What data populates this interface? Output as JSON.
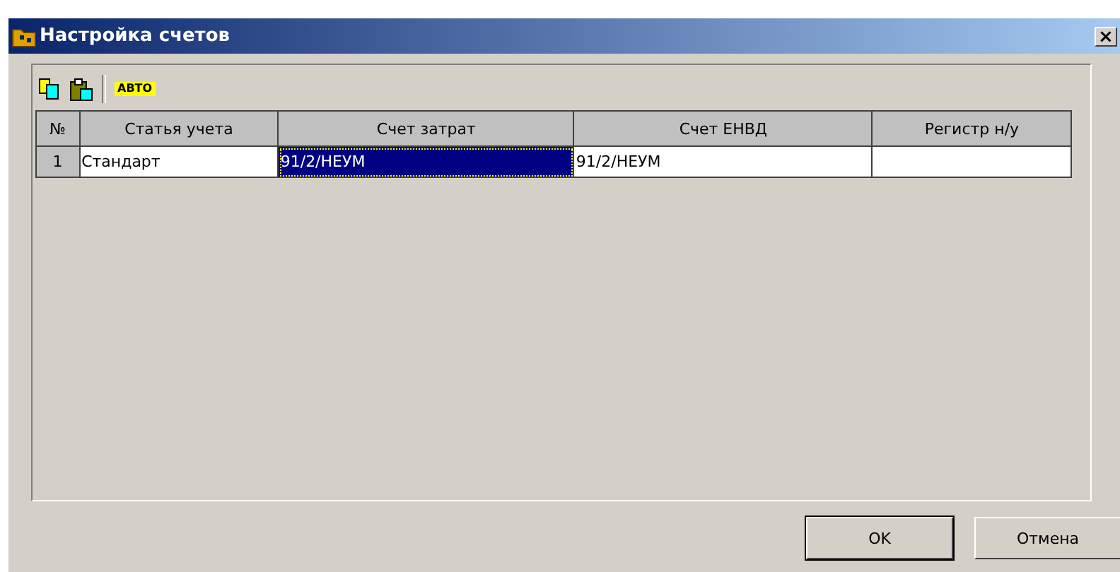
{
  "window": {
    "title": "Настройка счетов",
    "close": "×"
  },
  "toolbar": [
    {
      "kind": "copy"
    },
    {
      "kind": "paste"
    },
    {
      "kind": "separator"
    },
    {
      "kind": "auto",
      "label": "АВТО"
    }
  ],
  "table": {
    "columns": [
      "№",
      "Статья учета",
      "Счет затрат",
      "Счет ЕНВД",
      "Регистр н/у"
    ],
    "rows": [
      {
        "cells": [
          {
            "text": "1",
            "selected": false
          },
          {
            "text": "Стандарт",
            "selected": false
          },
          {
            "text": "91/2/НЕУМ",
            "selected": true
          },
          {
            "text": "91/2/НЕУМ",
            "selected": false
          },
          {
            "text": "",
            "selected": false
          }
        ]
      }
    ]
  },
  "buttons": [
    {
      "label": "OK",
      "default": true
    },
    {
      "label": "Отмена",
      "default": false
    }
  ]
}
